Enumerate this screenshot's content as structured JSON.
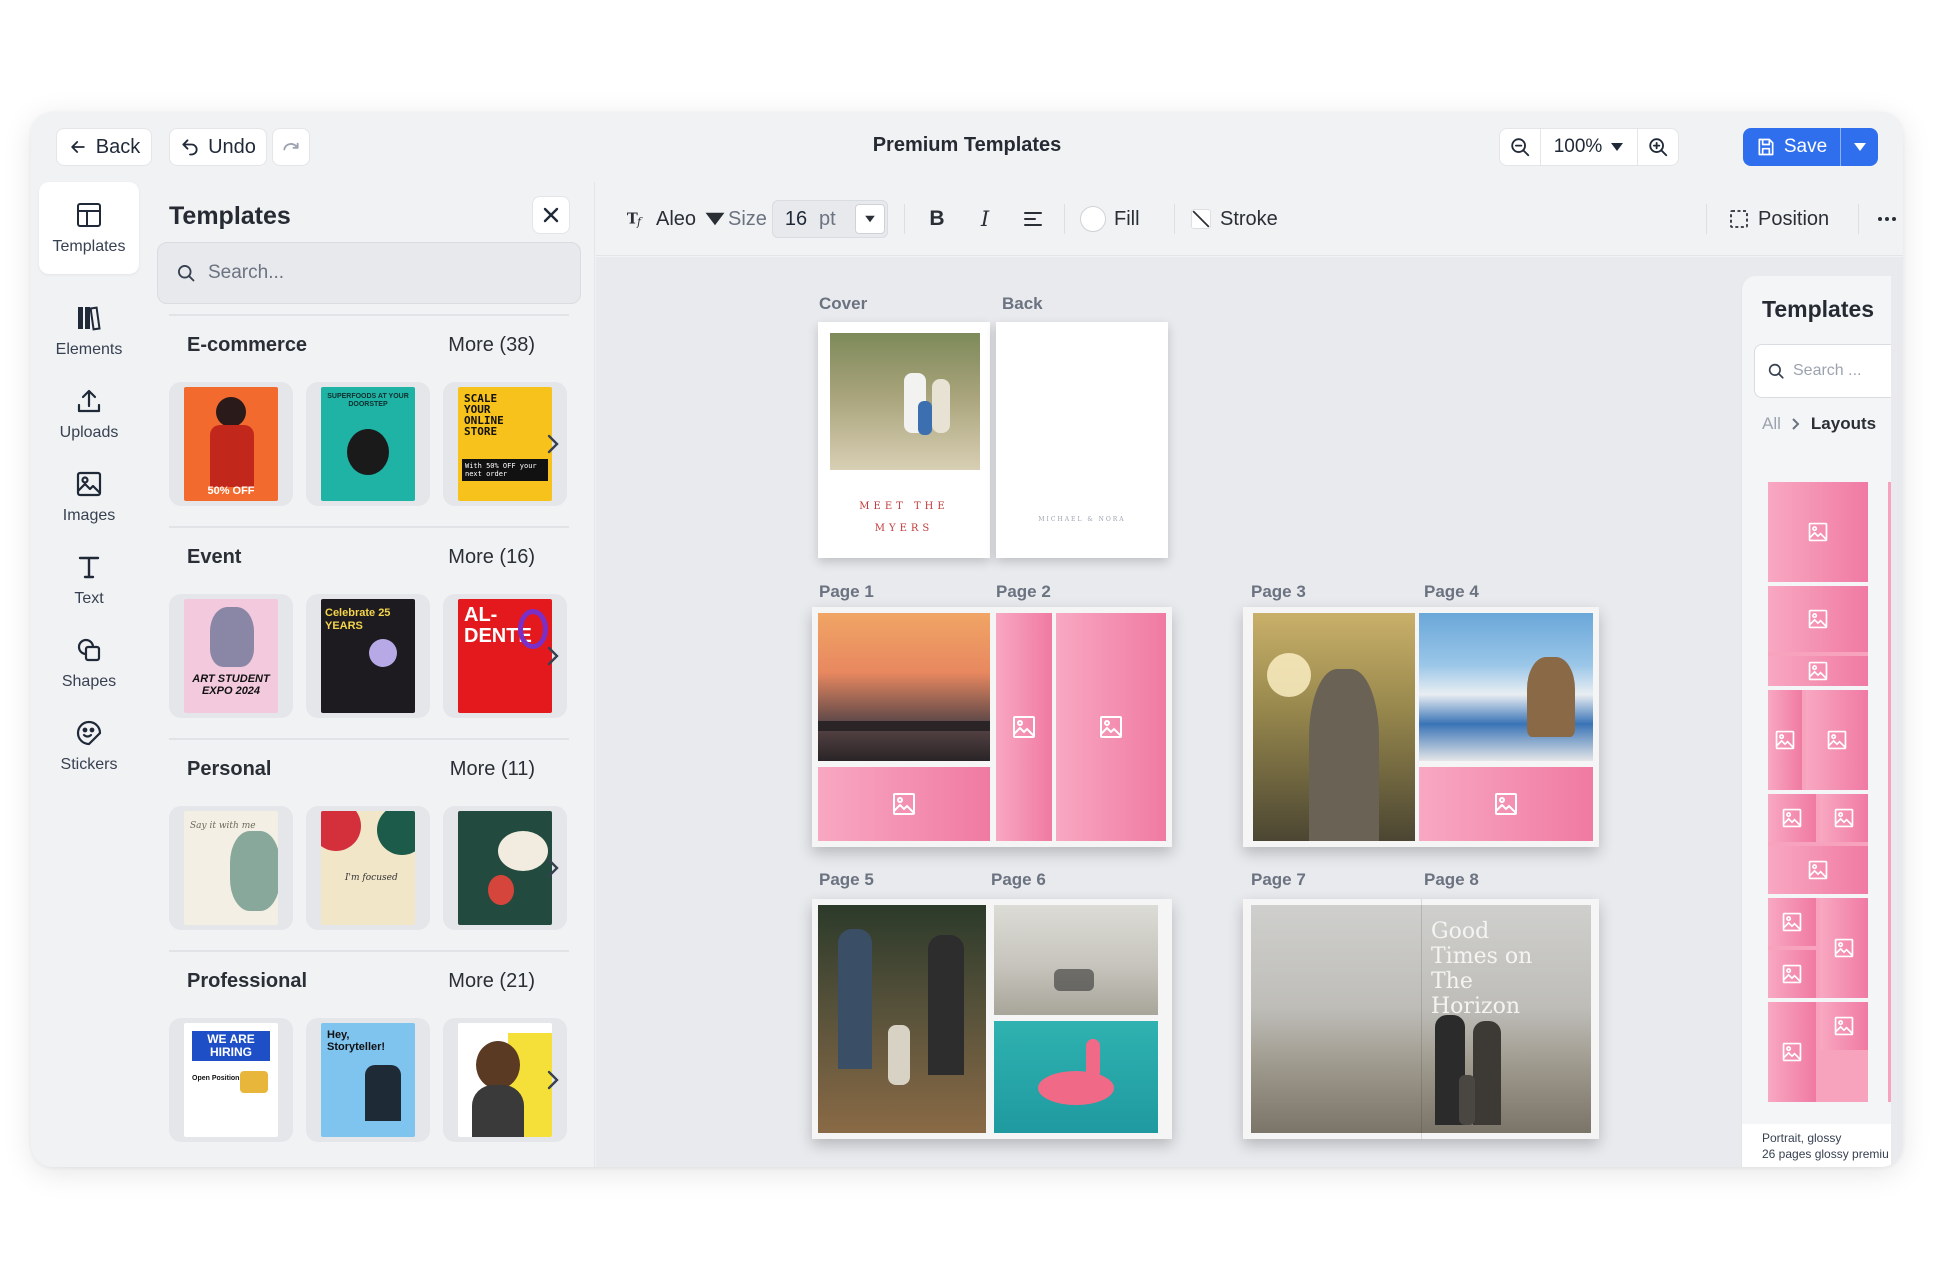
{
  "topbar": {
    "back_label": "Back",
    "undo_label": "Undo",
    "title": "Premium Templates",
    "zoom_value": "100%",
    "save_label": "Save"
  },
  "rail": {
    "items": [
      {
        "label": "Templates",
        "icon": "template-icon"
      },
      {
        "label": "Elements",
        "icon": "elements-icon"
      },
      {
        "label": "Uploads",
        "icon": "upload-icon"
      },
      {
        "label": "Images",
        "icon": "image-icon"
      },
      {
        "label": "Text",
        "icon": "text-icon"
      },
      {
        "label": "Shapes",
        "icon": "shapes-icon"
      },
      {
        "label": "Stickers",
        "icon": "sticker-icon"
      }
    ]
  },
  "panel": {
    "title": "Templates",
    "search_placeholder": "Search...",
    "categories": [
      {
        "name": "E-commerce",
        "more": "More (38)",
        "thumb_texts": [
          "50% OFF",
          "SUPERFOODS AT YOUR DOORSTEP",
          "SCALE YOUR ONLINE STORE",
          "With 50% OFF your next order"
        ]
      },
      {
        "name": "Event",
        "more": "More (16)",
        "thumb_texts": [
          "ART STUDENT EXPO 2024",
          "Celebrate 25 YEARS",
          "AL-DENTE"
        ]
      },
      {
        "name": "Personal",
        "more": "More (11)",
        "thumb_texts": [
          "Say it with me",
          "I'm focused"
        ]
      },
      {
        "name": "Professional",
        "more": "More (21)",
        "thumb_texts": [
          "WE ARE HIRING",
          "Open Positions",
          "Hey, Storyteller!"
        ]
      }
    ]
  },
  "toolbar": {
    "font": "Aleo",
    "size_label": "Size",
    "size_value": "16",
    "size_unit": "pt",
    "fill_label": "Fill",
    "stroke_label": "Stroke",
    "position_label": "Position"
  },
  "canvas": {
    "labels": [
      "Cover",
      "Back",
      "Page 1",
      "Page 2",
      "Page 3",
      "Page 4",
      "Page 5",
      "Page 6",
      "Page 7",
      "Page 8"
    ],
    "cover_title_line1": "MEET THE",
    "cover_title_line2": "MYERS",
    "back_text": "MICHAEL & NORA",
    "page8_text": "Good Times on The Horizon"
  },
  "right_panel": {
    "title": "Templates",
    "search_placeholder": "Search ...",
    "crumb_all": "All",
    "crumb_current": "Layouts",
    "footer_line1": "Portrait, glossy",
    "footer_line2": "26 pages glossy premiu"
  },
  "colors": {
    "accent": "#2f6fed",
    "placeholder_pink_light": "#f8a8c2",
    "placeholder_pink_dark": "#f07aa2",
    "window_bg": "#f1f2f4",
    "canvas_bg": "#e8eaee"
  }
}
